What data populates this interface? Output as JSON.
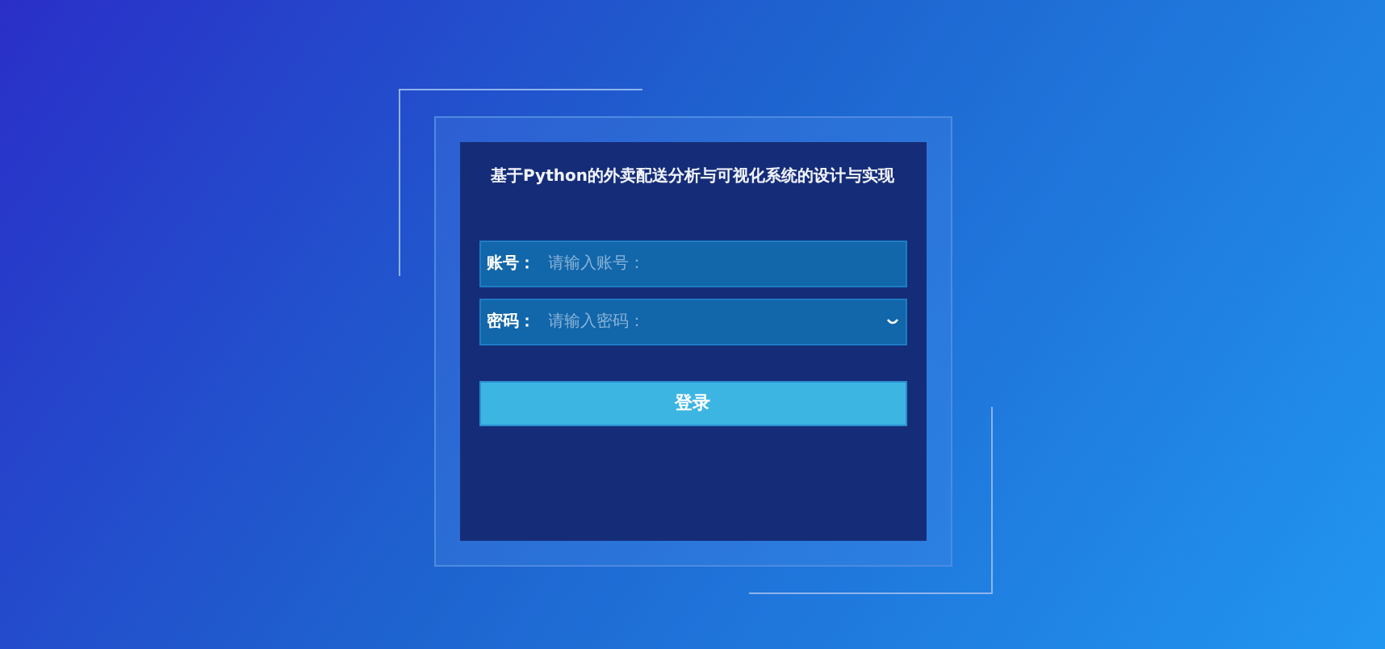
{
  "title": "基于Python的外卖配送分析与可视化系统的设计与实现",
  "fields": [
    {
      "label": "账号：",
      "placeholder": "请输入账号：",
      "kind": "text"
    },
    {
      "label": "密码：",
      "placeholder": "请输入密码：",
      "kind": "password"
    }
  ],
  "login_button": "登录"
}
